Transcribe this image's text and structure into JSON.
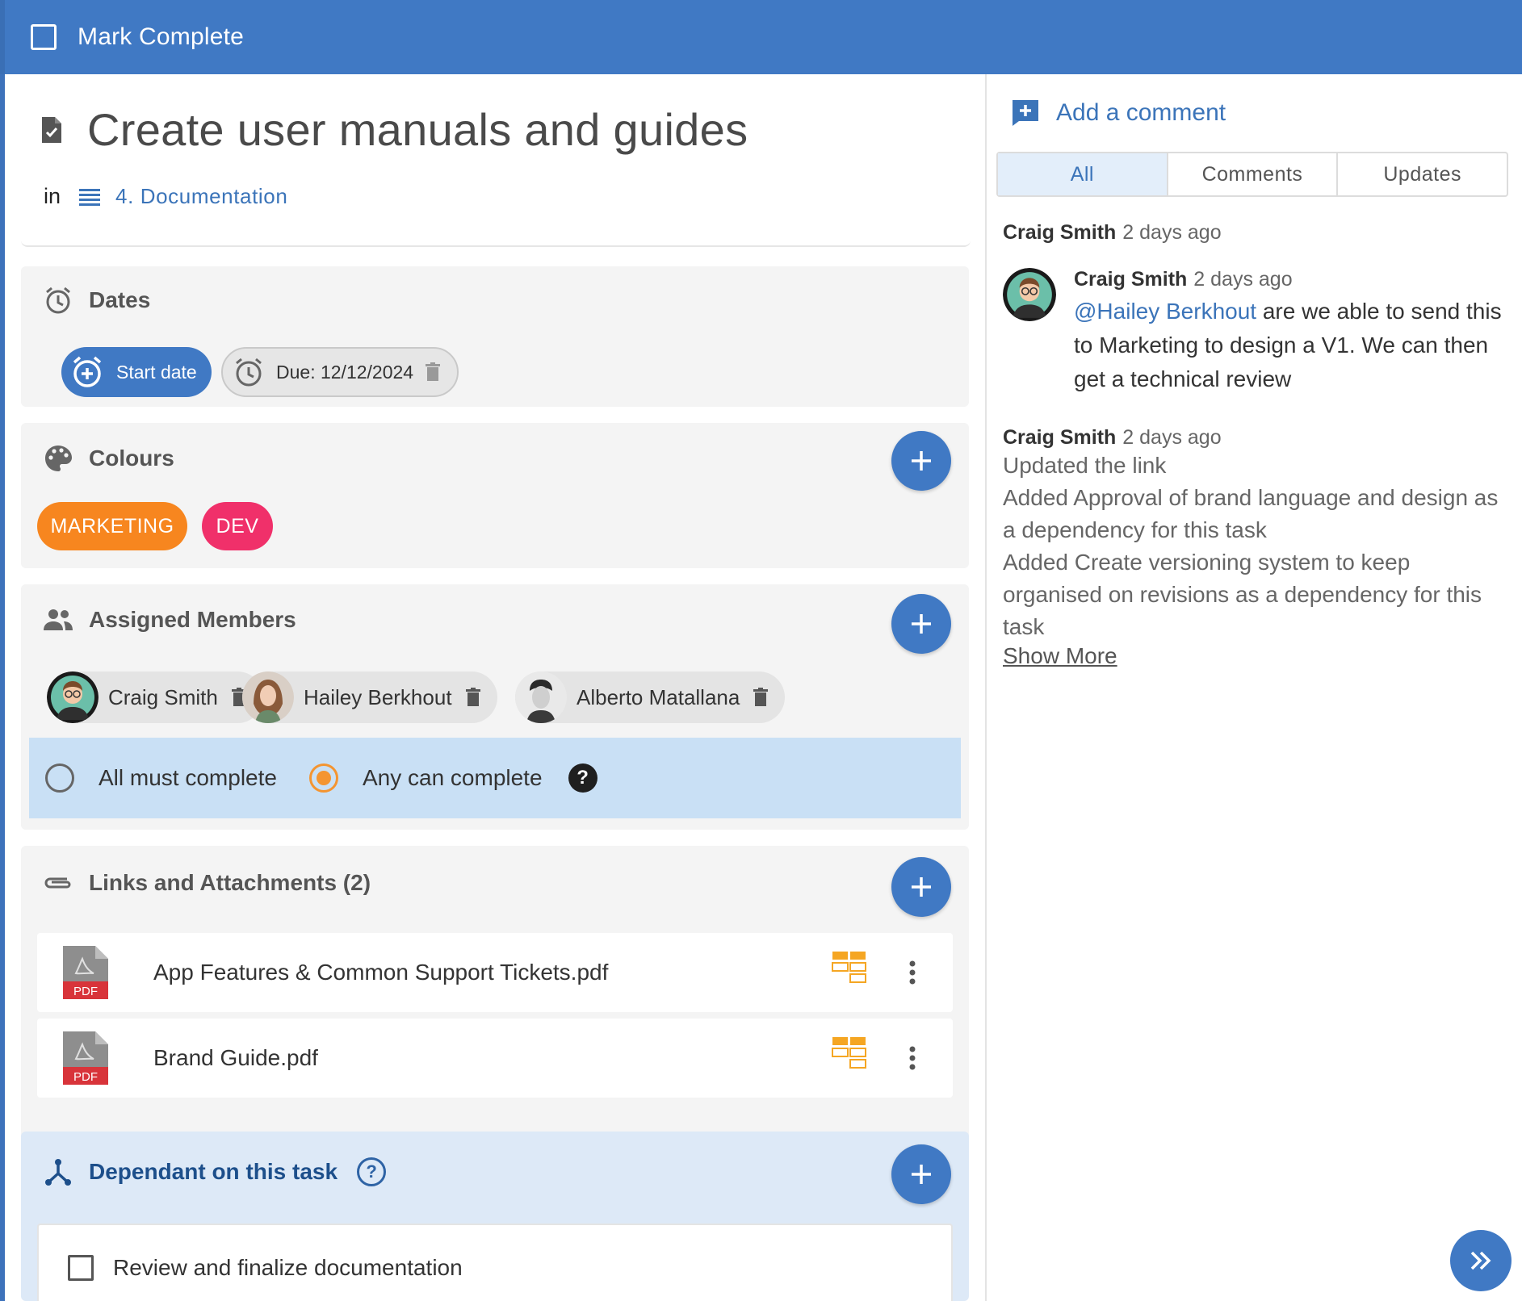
{
  "topbar": {
    "mark_complete_label": "Mark Complete"
  },
  "task": {
    "title": "Create user manuals and guides",
    "in_label": "in",
    "list_name": "4. Documentation"
  },
  "dates": {
    "heading": "Dates",
    "start_label": "Start date",
    "due_label": "Due: 12/12/2024"
  },
  "colours": {
    "heading": "Colours",
    "tags": [
      {
        "label": "MARKETING",
        "color": "#f7861f"
      },
      {
        "label": "DEV",
        "color": "#f0306a"
      }
    ]
  },
  "members": {
    "heading": "Assigned Members",
    "list": [
      {
        "name": "Craig Smith"
      },
      {
        "name": "Hailey Berkhout"
      },
      {
        "name": "Alberto Matallana"
      }
    ],
    "all_must_complete": "All must complete",
    "any_can_complete": "Any can complete",
    "selected_mode": "any"
  },
  "attachments": {
    "heading": "Links and Attachments (2)",
    "pdf_badge": "PDF",
    "files": [
      {
        "name": "App Features & Common Support Tickets.pdf"
      },
      {
        "name": "Brand Guide.pdf"
      }
    ]
  },
  "dependant": {
    "heading": "Dependant on this task",
    "items": [
      {
        "label": "Review and finalize documentation",
        "checked": false
      }
    ]
  },
  "comments_panel": {
    "add_comment_label": "Add a comment",
    "tabs": [
      {
        "label": "All"
      },
      {
        "label": "Comments"
      },
      {
        "label": "Updates"
      }
    ],
    "active_tab": "All",
    "entries": [
      {
        "author": "Craig Smith",
        "time": "2 days ago"
      },
      {
        "author": "Craig Smith",
        "time": "2 days ago",
        "mention": "@Hailey Berkhout",
        "text": " are we able to send this to Marketing to design a V1. We can then get a technical review"
      },
      {
        "author": "Craig Smith",
        "time": "2 days ago",
        "updates": [
          "Updated the link",
          "Added Approval of brand language and design as a dependency for this task",
          "Added Create versioning system to keep organised on revisions as a dependency for this task"
        ],
        "show_more": "Show More"
      }
    ]
  },
  "colors": {
    "accent": "#4079c4",
    "link": "#3b74b9",
    "radio_selected": "#f49531"
  }
}
